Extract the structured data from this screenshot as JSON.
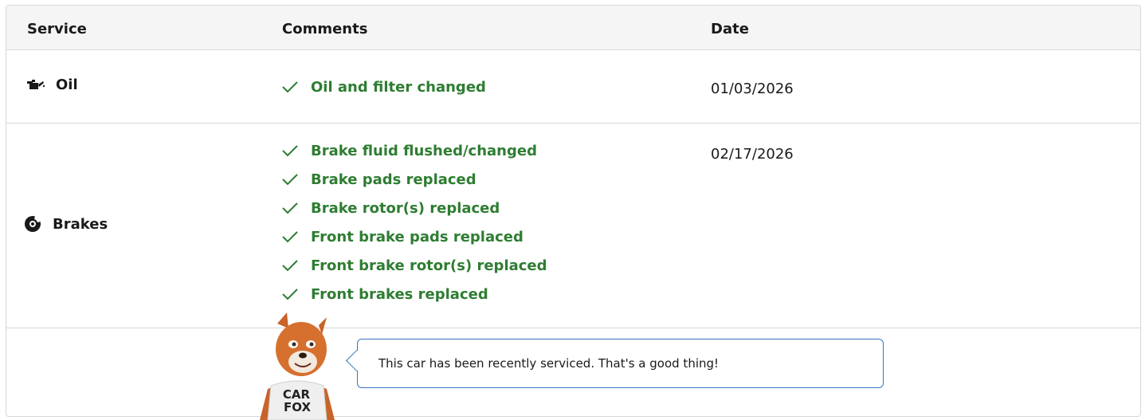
{
  "headers": {
    "service": "Service",
    "comments": "Comments",
    "date": "Date"
  },
  "rows": [
    {
      "service": "Oil",
      "icon": "oil-can-icon",
      "comments": [
        "Oil and filter changed"
      ],
      "date": "01/03/2026"
    },
    {
      "service": "Brakes",
      "icon": "brake-disc-icon",
      "comments": [
        "Brake fluid flushed/changed",
        "Brake pads replaced",
        "Brake rotor(s) replaced",
        "Front brake pads replaced",
        "Front brake rotor(s) replaced",
        "Front brakes replaced"
      ],
      "date": "02/17/2026"
    }
  ],
  "mascot": {
    "shirt_line1": "CAR",
    "shirt_line2": "FOX"
  },
  "message": "This car has been recently serviced. That's a good thing!",
  "colors": {
    "accent_green": "#2e7d32",
    "bubble_border": "#3777bc",
    "header_bg": "#f5f5f5",
    "border": "#d7d7d7"
  }
}
